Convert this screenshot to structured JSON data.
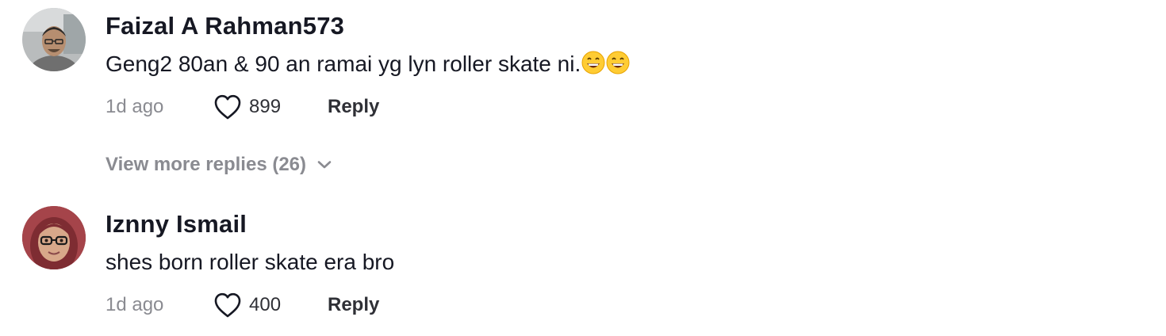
{
  "comments": [
    {
      "username": "Faizal A Rahman573",
      "text": "Geng2 80an & 90 an ramai yg lyn roller skate ni.",
      "emojis": [
        "grinning-face-emoji",
        "grinning-face-emoji"
      ],
      "time": "1d ago",
      "likes": "899",
      "reply_label": "Reply",
      "view_more": "View more replies (26)"
    },
    {
      "username": "Iznny Ismail",
      "text": "shes born roller skate era bro",
      "time": "1d ago",
      "likes": "400",
      "reply_label": "Reply"
    }
  ],
  "icons": {
    "like": "heart-outline-icon",
    "expand": "chevron-down-icon"
  },
  "colors": {
    "primary_text": "#161823",
    "secondary_text": "#8a8b91",
    "action_text": "#2f3036"
  }
}
